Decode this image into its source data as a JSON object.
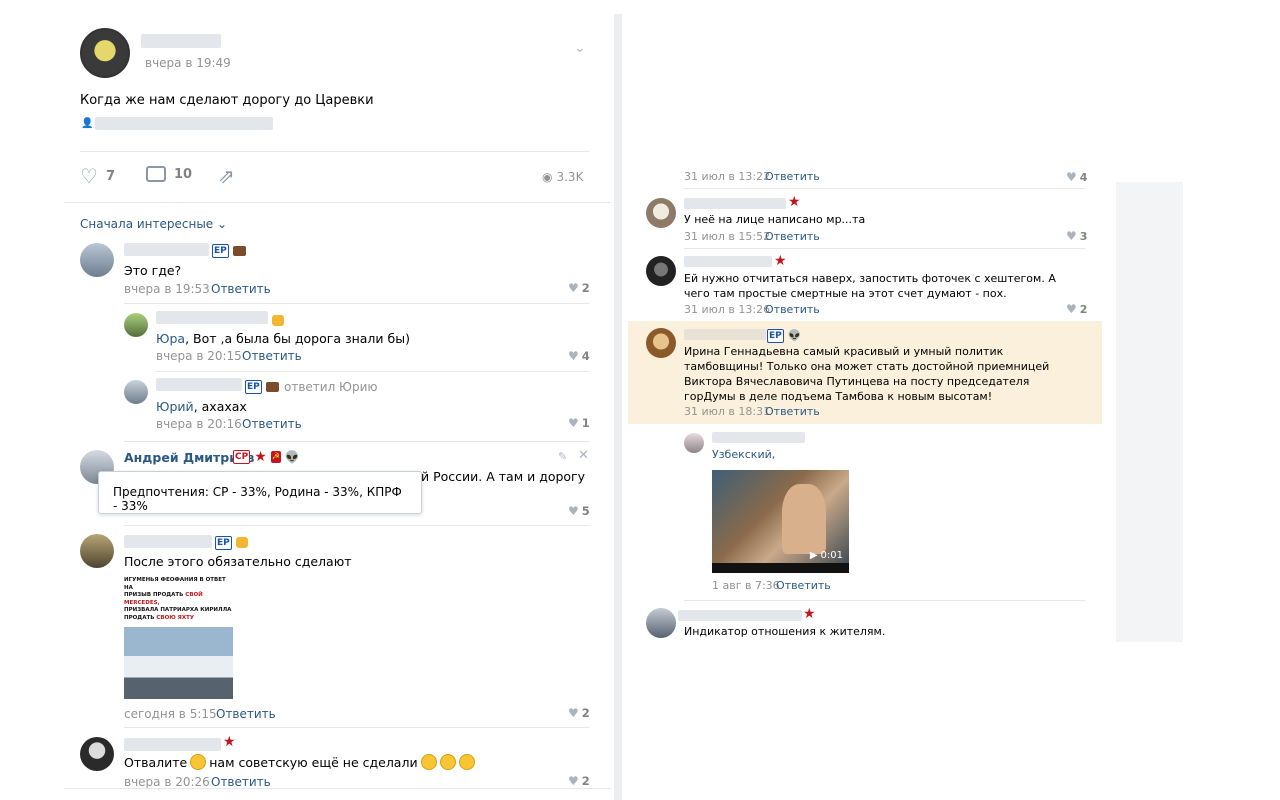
{
  "post": {
    "time": "вчера в 19:49",
    "text": "Когда же нам сделают дорогу до Царевки",
    "likes": "7",
    "comments": "10",
    "views": "3.3K"
  },
  "sort_label": "Сначала интересные",
  "reply_label": "Ответить",
  "left_comments": [
    {
      "text": "Это где?",
      "time": "вчера в 19:53",
      "likes": "2"
    },
    {
      "addressee": "Юра",
      "text": ", Вот ,а была бы дорога знали бы)",
      "time": "вчера в 20:15",
      "likes": "4"
    },
    {
      "replied": "ответил Юрию",
      "addressee": "Юрий",
      "text": ", ахахах",
      "time": "вчера в 20:16",
      "likes": "1"
    },
    {
      "name": "Андрей Дмитриев",
      "text_tail": "й России. А там и дорогу",
      "likes": "5"
    },
    {
      "text": "После этого обязательно сделают",
      "time": "сегодня в 5:15",
      "likes": "2"
    },
    {
      "text_a": "Отвалите",
      "text_b": "нам советскую ещё не сделали",
      "time": "вчера в 20:26",
      "likes": "2"
    }
  ],
  "tooltip": "Предпочтения: СР - 33%, Родина - 33%, КПРФ - 33%",
  "meme_lines": [
    "ИГУМЕНЬЯ ФЕОФАНИЯ В ОТВЕТ НА",
    "ПРИЗЫВ ПРОДАТЬ",
    "СВОЙ MERCEDES,",
    "ПРИЗВАЛА ПАТРИАРХА КИРИЛЛА",
    "ПРОДАТЬ",
    "СВОЮ ЯХТУ"
  ],
  "right_comments": [
    {
      "time": "31 июл в 13:22",
      "likes": "4"
    },
    {
      "text": "У неё на лице написано мр...та",
      "time": "31 июл в 15:52",
      "likes": "3"
    },
    {
      "text": "Ей нужно отчитаться наверх, запостить фоточек с хештегом. А чего там простые смертные на этот счет думают - пох.",
      "time": "31 июл в 13:26",
      "likes": "2"
    },
    {
      "text": "Ирина Геннадьевна самый красивый и умный политик тамбовщины! Только она может стать достойной приемницей Виктора Вячеславовича Путинцева на посту председателя горДумы в деле подъема Тамбова к новым высотам!",
      "time": "31 июл в 18:31"
    },
    {
      "addressee": "Узбекский,",
      "video_duration": "0:01",
      "time": "1 авг в 7:36"
    },
    {
      "text": "Индикатор отношения к жителям."
    }
  ],
  "colors": {
    "link": "#2a5885",
    "highlight": "#fbf0dc",
    "muted": "#939393"
  }
}
